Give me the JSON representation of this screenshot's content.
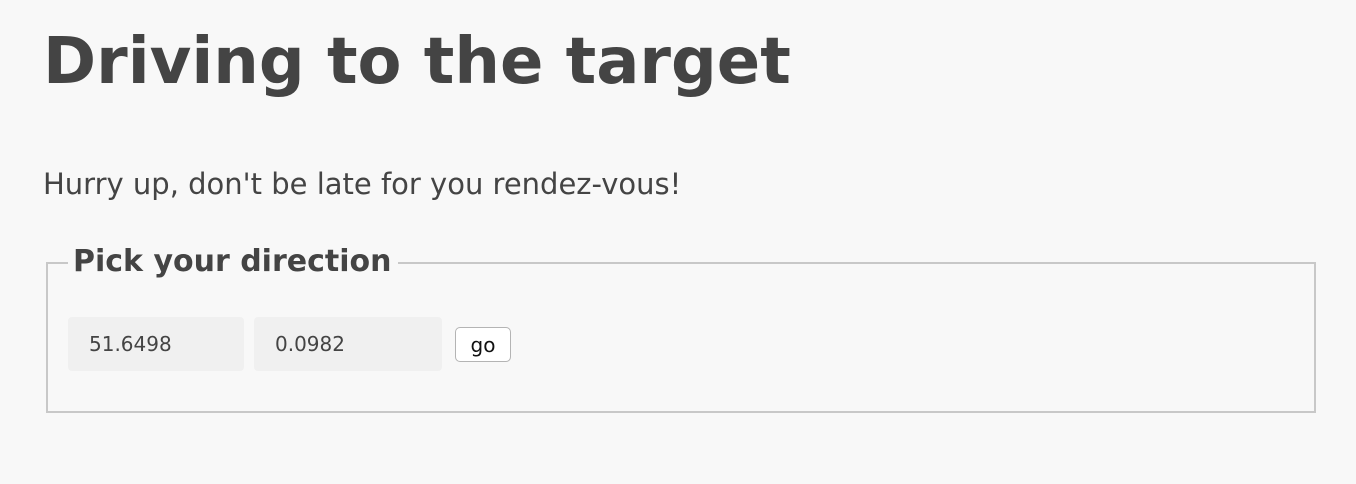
{
  "page": {
    "title": "Driving to the target",
    "intro": "Hurry up, don't be late for you rendez-vous!"
  },
  "direction_form": {
    "legend": "Pick your direction",
    "latitude_value": "51.6498",
    "longitude_value": "0.0982",
    "go_label": "go"
  }
}
